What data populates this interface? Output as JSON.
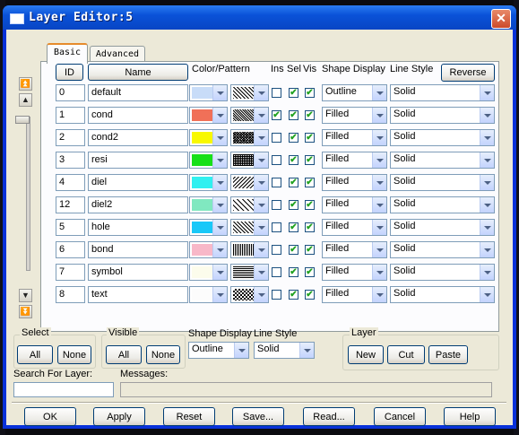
{
  "window": {
    "title": "Layer Editor:5",
    "close_label": "✕"
  },
  "tabs": [
    {
      "label": "Basic"
    },
    {
      "label": "Advanced"
    }
  ],
  "table": {
    "headers": {
      "id": "ID",
      "name": "Name",
      "color_pattern": "Color/Pattern",
      "ins": "Ins",
      "sel": "Sel",
      "vis": "Vis",
      "shape_display": "Shape Display",
      "line_style": "Line Style",
      "reverse": "Reverse"
    },
    "rows": [
      {
        "id": "0",
        "name": "default",
        "color": "#c8dcf8",
        "pattern": "diag-dense",
        "ins": false,
        "sel": true,
        "vis": true,
        "shape": "Outline",
        "line": "Solid"
      },
      {
        "id": "1",
        "name": "cond",
        "color": "#f07058",
        "pattern": "diag-mixed",
        "ins": true,
        "sel": true,
        "vis": true,
        "shape": "Filled",
        "line": "Solid"
      },
      {
        "id": "2",
        "name": "cond2",
        "color": "#f8f800",
        "pattern": "cross-fine",
        "ins": false,
        "sel": true,
        "vis": true,
        "shape": "Filled",
        "line": "Solid"
      },
      {
        "id": "3",
        "name": "resi",
        "color": "#18e018",
        "pattern": "grid-dense",
        "ins": false,
        "sel": true,
        "vis": true,
        "shape": "Filled",
        "line": "Solid"
      },
      {
        "id": "4",
        "name": "diel",
        "color": "#30f0f0",
        "pattern": "diag-wide",
        "ins": false,
        "sel": true,
        "vis": true,
        "shape": "Filled",
        "line": "Solid"
      },
      {
        "id": "12",
        "name": "diel2",
        "color": "#80e8c0",
        "pattern": "diag-light",
        "ins": false,
        "sel": true,
        "vis": true,
        "shape": "Filled",
        "line": "Solid"
      },
      {
        "id": "5",
        "name": "hole",
        "color": "#18c8f8",
        "pattern": "diag-dense",
        "ins": false,
        "sel": true,
        "vis": true,
        "shape": "Filled",
        "line": "Solid"
      },
      {
        "id": "6",
        "name": "bond",
        "color": "#f8b8c8",
        "pattern": "vertical",
        "ins": false,
        "sel": true,
        "vis": true,
        "shape": "Filled",
        "line": "Solid"
      },
      {
        "id": "7",
        "name": "symbol",
        "color": "#fcfcec",
        "pattern": "horizontal",
        "ins": false,
        "sel": true,
        "vis": true,
        "shape": "Filled",
        "line": "Solid"
      },
      {
        "id": "8",
        "name": "text",
        "color": "#fcfcfc",
        "pattern": "checker",
        "ins": false,
        "sel": true,
        "vis": true,
        "shape": "Filled",
        "line": "Solid"
      }
    ]
  },
  "select_group": {
    "label": "Select",
    "all": "All",
    "none": "None"
  },
  "visible_group": {
    "label": "Visible",
    "all": "All",
    "none": "None"
  },
  "shape_display": {
    "label": "Shape Display",
    "value": "Outline"
  },
  "line_style": {
    "label": "Line Style",
    "value": "Solid"
  },
  "layer_group": {
    "label": "Layer",
    "new": "New",
    "cut": "Cut",
    "paste": "Paste"
  },
  "search": {
    "label": "Search For Layer:",
    "value": ""
  },
  "messages": {
    "label": "Messages:",
    "value": ""
  },
  "footer": {
    "ok": "OK",
    "apply": "Apply",
    "reset": "Reset",
    "save": "Save...",
    "read": "Read...",
    "cancel": "Cancel",
    "help": "Help"
  }
}
